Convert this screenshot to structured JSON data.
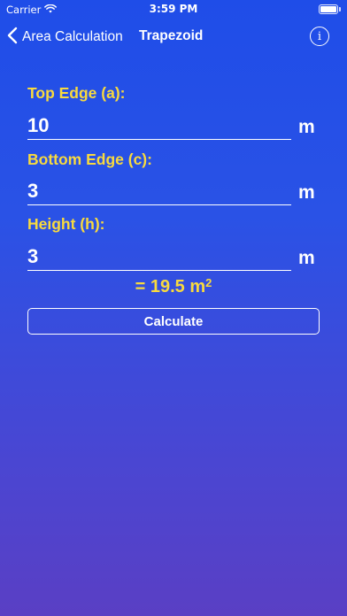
{
  "status_bar": {
    "carrier": "Carrier",
    "time": "3:59 PM",
    "wifi_icon": "wifi-icon",
    "battery_icon": "battery-icon"
  },
  "nav": {
    "back_label": "Area Calculation",
    "back_icon": "chevron-left-icon",
    "title": "Trapezoid",
    "info_icon": "info-circle-icon"
  },
  "fields": [
    {
      "label": "Top Edge (a):",
      "value": "10",
      "unit": "m"
    },
    {
      "label": "Bottom Edge (c):",
      "value": "3",
      "unit": "m"
    },
    {
      "label": "Height (h):",
      "value": "3",
      "unit": "m"
    }
  ],
  "result": {
    "prefix": "= ",
    "value": "19.5",
    "unit": "m",
    "unit_superscript": "2"
  },
  "calculate_button": {
    "label": "Calculate"
  },
  "colors": {
    "accent": "#f8da3e",
    "background_top": "#1f4de8",
    "background_bottom": "#5a3fc4",
    "text": "#ffffff"
  }
}
